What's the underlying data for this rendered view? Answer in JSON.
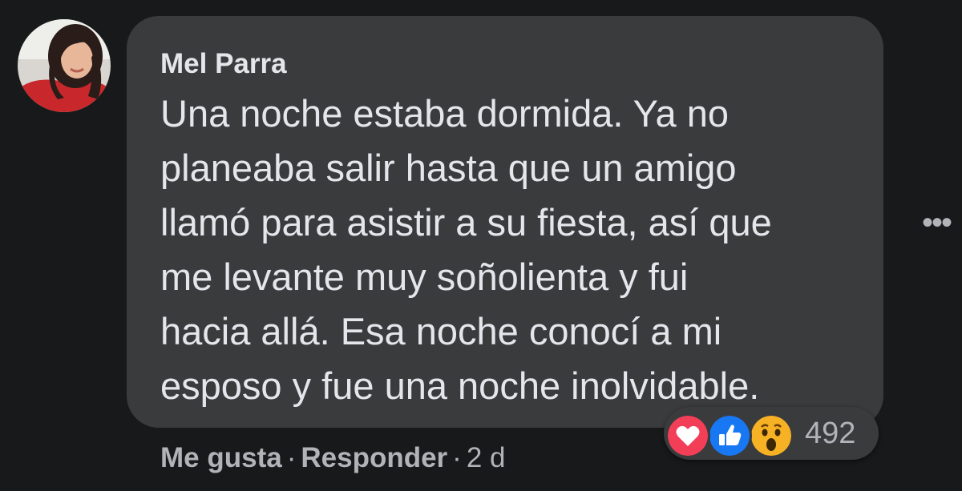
{
  "comment": {
    "author": "Mel Parra",
    "text_lines": [
      "Una noche estaba dormida. Ya no",
      "planeaba salir hasta que un amigo",
      "llamó para asistir a su fiesta, así que",
      "me levante muy soñolienta y fui",
      "hacia allá. Esa noche conocí a mi",
      "esposo y fue una noche inolvidable."
    ],
    "reactions": {
      "icons": [
        "love-icon",
        "like-icon",
        "wow-icon"
      ],
      "count": "492"
    },
    "actions": {
      "like_label": "Me gusta",
      "separator": "·",
      "reply_label": "Responder",
      "time": "2 d"
    },
    "more_label": "•••"
  },
  "colors": {
    "background": "#18191a",
    "bubble": "#3a3b3c",
    "primary_text": "#e4e6eb",
    "secondary_text": "#b0b3b8",
    "love": "#f33e58",
    "like": "#1877f2",
    "wow": "#f7b125"
  }
}
